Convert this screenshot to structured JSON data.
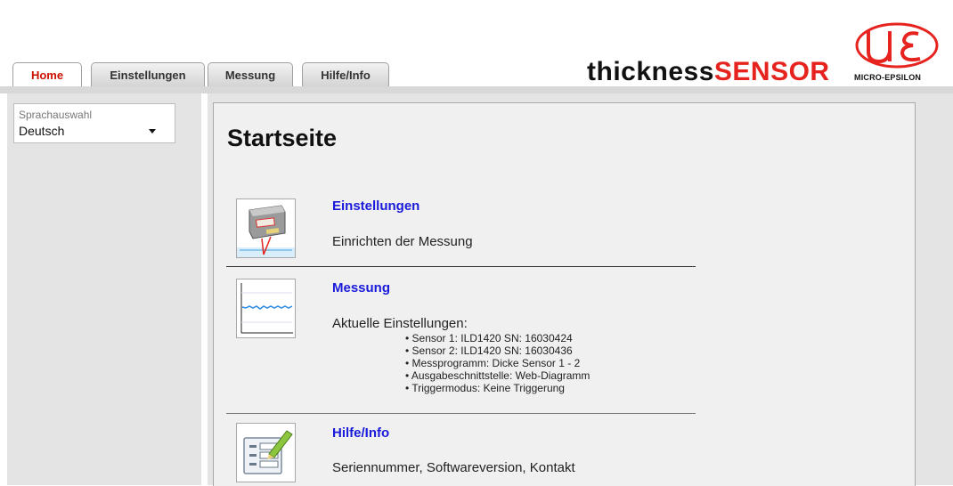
{
  "tabs": [
    {
      "label": "Home",
      "active": true
    },
    {
      "label": "Einstellungen",
      "active": false
    },
    {
      "label": "Messung",
      "active": false
    },
    {
      "label": "Hilfe/Info",
      "active": false
    }
  ],
  "brand": {
    "part1": "thickness",
    "part2": "SENSOR",
    "accent": "#e6231e"
  },
  "logo": {
    "text": "MICRO-EPSILON",
    "color": "#e6231e"
  },
  "language": {
    "label": "Sprachauswahl",
    "selected": "Deutsch"
  },
  "page": {
    "title": "Startseite"
  },
  "sections": {
    "settings": {
      "title": "Einstellungen",
      "description": "Einrichten der Messung",
      "icon": "sensor-icon"
    },
    "measurement": {
      "title": "Messung",
      "description": "Aktuelle Einstellungen:",
      "icon": "chart-icon",
      "details": [
        "• Sensor 1: ILD1420 SN: 16030424",
        "• Sensor 2: ILD1420 SN: 16030436",
        "• Messprogramm: Dicke Sensor 1 - 2",
        "• Ausgabeschnittstelle: Web-Diagramm",
        "• Triggermodus: Keine Triggerung"
      ]
    },
    "help": {
      "title": "Hilfe/Info",
      "description": "Seriennummer, Softwareversion, Kontakt",
      "icon": "document-edit-icon"
    }
  },
  "colors": {
    "link": "#1a1adb",
    "active_tab": "#cc1100"
  }
}
